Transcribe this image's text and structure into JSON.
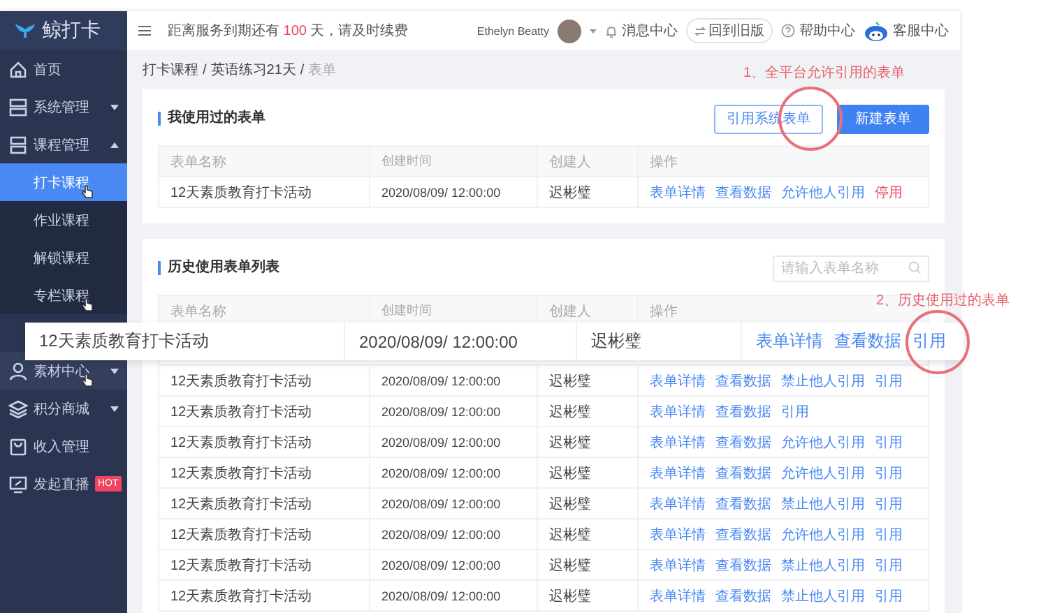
{
  "sidebar": {
    "logo": "鲸打卡",
    "items": [
      {
        "label": "首页",
        "selected": false,
        "hover": false,
        "cursor": false
      },
      {
        "label": "系统管理",
        "selected": false,
        "hover": false,
        "cursor": false,
        "expanded": false
      },
      {
        "label": "课程管理",
        "selected": false,
        "hover": false,
        "cursor": false,
        "expanded": true,
        "children": [
          {
            "label": "打卡课程",
            "selected": true,
            "hover": false,
            "cursor": true
          },
          {
            "label": "作业课程",
            "selected": false,
            "hover": false,
            "cursor": false
          },
          {
            "label": "解锁课程",
            "selected": false,
            "hover": false,
            "cursor": false
          },
          {
            "label": "专栏课程",
            "selected": false,
            "hover": false,
            "cursor": true
          }
        ]
      },
      {
        "label": "素材中心",
        "selected": false,
        "hover": true,
        "cursor": true,
        "expanded": false
      },
      {
        "label": "积分商城",
        "selected": false,
        "hover": false,
        "cursor": false,
        "expanded": false
      },
      {
        "label": "收入管理",
        "selected": false,
        "hover": false,
        "cursor": false
      },
      {
        "label": "发起直播",
        "selected": false,
        "hover": false,
        "cursor": false,
        "badge": "HOT"
      }
    ]
  },
  "header": {
    "notice_before": "距离服务到期还有",
    "notice_days": "100",
    "notice_after": "天，请及时续费",
    "user": "Ethelyn Beatty",
    "links": [
      {
        "kind": "bell",
        "label": "消息中心"
      },
      {
        "kind": "switch",
        "label": "回到旧版"
      },
      {
        "kind": "help",
        "label": "帮助中心"
      },
      {
        "kind": "mascot",
        "label": "客服中心"
      }
    ]
  },
  "breadcrumb": {
    "separator": "/",
    "items": [
      {
        "label": "打卡课程",
        "current": false
      },
      {
        "label": "英语练习21天",
        "current": false
      },
      {
        "label": "表单",
        "current": true
      }
    ]
  },
  "used_forms": {
    "title": "我使用过的表单",
    "buttons": [
      {
        "label": "引用系统表单",
        "kind": "outline"
      },
      {
        "label": "新建表单",
        "kind": "primary"
      }
    ],
    "columns": [
      "表单名称",
      "创建时间",
      "创建人",
      "操作"
    ],
    "rows": [
      {
        "cells": [
          "12天素质教育打卡活动",
          "2020/08/09/ 12:00:00",
          "迟彬璧"
        ],
        "actions": [
          {
            "label": "表单详情",
            "kind": "link"
          },
          {
            "label": "查看数据",
            "kind": "link"
          },
          {
            "label": "允许他人引用",
            "kind": "link"
          },
          {
            "label": "停用",
            "kind": "danger"
          }
        ]
      }
    ]
  },
  "history_forms": {
    "title": "历史使用表单列表",
    "search": {
      "placeholder": "请输入表单名称"
    },
    "columns": [
      "表单名称",
      "创建时间",
      "创建人",
      "操作"
    ],
    "rows": [
      {
        "cells": [
          "12天素质教育打卡活动",
          "2020/08/09/ 12:00:00",
          "迟彬璧"
        ],
        "actions": [
          {
            "label": "表单详情",
            "kind": "link"
          },
          {
            "label": "查看数据",
            "kind": "link"
          },
          {
            "label": "禁止他人引用",
            "kind": "link"
          },
          {
            "label": "引用",
            "kind": "link"
          }
        ]
      },
      {
        "cells": [
          "12天素质教育打卡活动",
          "2020/08/09/ 12:00:00",
          "迟彬璧"
        ],
        "actions": [
          {
            "label": "表单详情",
            "kind": "link"
          },
          {
            "label": "查看数据",
            "kind": "link"
          },
          {
            "label": "引用",
            "kind": "link"
          }
        ]
      },
      {
        "cells": [
          "12天素质教育打卡活动",
          "2020/08/09/ 12:00:00",
          "迟彬璧"
        ],
        "actions": [
          {
            "label": "表单详情",
            "kind": "link"
          },
          {
            "label": "查看数据",
            "kind": "link"
          },
          {
            "label": "允许他人引用",
            "kind": "link"
          },
          {
            "label": "引用",
            "kind": "link"
          }
        ]
      },
      {
        "cells": [
          "12天素质教育打卡活动",
          "2020/08/09/ 12:00:00",
          "迟彬璧"
        ],
        "actions": [
          {
            "label": "表单详情",
            "kind": "link"
          },
          {
            "label": "查看数据",
            "kind": "link"
          },
          {
            "label": "允许他人引用",
            "kind": "link"
          },
          {
            "label": "引用",
            "kind": "link"
          }
        ]
      },
      {
        "cells": [
          "12天素质教育打卡活动",
          "2020/08/09/ 12:00:00",
          "迟彬璧"
        ],
        "actions": [
          {
            "label": "表单详情",
            "kind": "link"
          },
          {
            "label": "查看数据",
            "kind": "link"
          },
          {
            "label": "禁止他人引用",
            "kind": "link"
          },
          {
            "label": "引用",
            "kind": "link"
          }
        ]
      },
      {
        "cells": [
          "12天素质教育打卡活动",
          "2020/08/09/ 12:00:00",
          "迟彬璧"
        ],
        "actions": [
          {
            "label": "表单详情",
            "kind": "link"
          },
          {
            "label": "查看数据",
            "kind": "link"
          },
          {
            "label": "允许他人引用",
            "kind": "link"
          },
          {
            "label": "引用",
            "kind": "link"
          }
        ]
      },
      {
        "cells": [
          "12天素质教育打卡活动",
          "2020/08/09/ 12:00:00",
          "迟彬璧"
        ],
        "actions": [
          {
            "label": "表单详情",
            "kind": "link"
          },
          {
            "label": "查看数据",
            "kind": "link"
          },
          {
            "label": "禁止他人引用",
            "kind": "link"
          },
          {
            "label": "引用",
            "kind": "link"
          }
        ]
      },
      {
        "cells": [
          "12天素质教育打卡活动",
          "2020/08/09/ 12:00:00",
          "迟彬璧"
        ],
        "actions": [
          {
            "label": "表单详情",
            "kind": "link"
          },
          {
            "label": "查看数据",
            "kind": "link"
          },
          {
            "label": "禁止他人引用",
            "kind": "link"
          },
          {
            "label": "引用",
            "kind": "link"
          }
        ]
      }
    ]
  },
  "zoomed_row": {
    "cells": [
      "12天素质教育打卡活动",
      "2020/08/09/ 12:00:00",
      "迟彬璧"
    ],
    "actions": [
      {
        "label": "表单详情",
        "kind": "link"
      },
      {
        "label": "查看数据",
        "kind": "link"
      },
      {
        "label": "引用",
        "kind": "link"
      }
    ]
  },
  "annotations": [
    {
      "text": "1、全平台允许引用的表单"
    },
    {
      "text": "2、历史使用过的表单"
    }
  ]
}
